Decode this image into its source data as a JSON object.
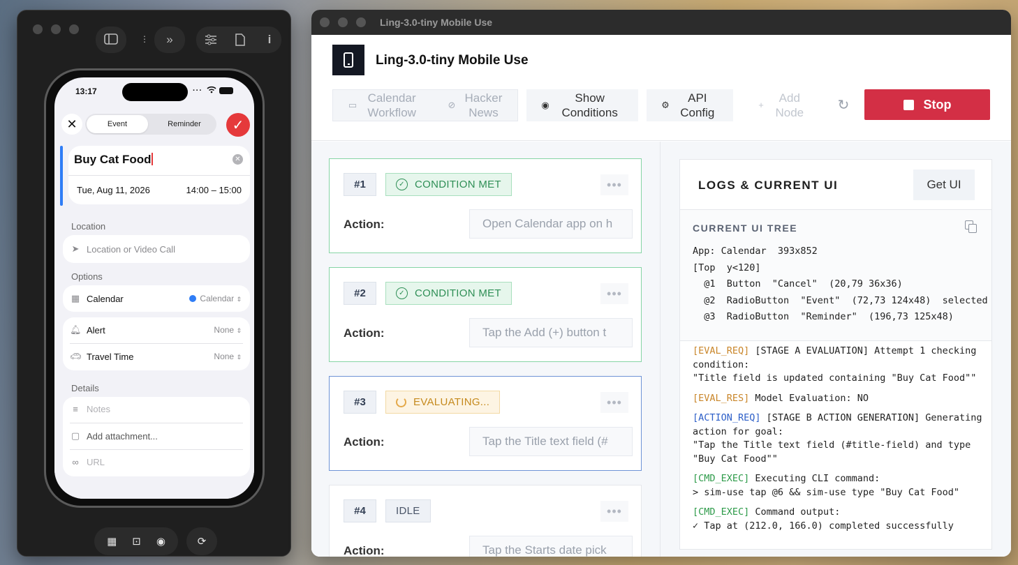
{
  "simulator": {
    "toolbar_icons": [
      "sidebar-icon",
      "hierarchy-icon",
      "forward-icon",
      "sliders-icon",
      "document-icon",
      "info-icon"
    ],
    "status_time": "13:17",
    "event_editor": {
      "segments": [
        "Event",
        "Reminder"
      ],
      "title_value": "Buy Cat Food",
      "date": "Tue, Aug 11, 2026",
      "time_range": "14:00 – 15:00",
      "location_label": "Location",
      "location_placeholder": "Location or Video Call",
      "options_label": "Options",
      "calendar_label": "Calendar",
      "calendar_value": "Calendar",
      "alert_label": "Alert",
      "alert_value": "None",
      "travel_label": "Travel Time",
      "travel_value": "None",
      "details_label": "Details",
      "notes_placeholder": "Notes",
      "attachment_label": "Add attachment...",
      "url_placeholder": "URL"
    },
    "dock_icons": [
      "grid-icon",
      "screenshot-icon",
      "record-icon",
      "rotate-icon"
    ]
  },
  "app": {
    "window_title": "Ling-3.0-tiny Mobile Use",
    "title": "Ling-3.0-tiny Mobile Use",
    "toolbar": {
      "calendar_workflow": "Calendar Workflow",
      "hacker_news": "Hacker News",
      "show_conditions": "Show Conditions",
      "api_config": "API Config",
      "add_node": "Add Node",
      "stop": "Stop"
    },
    "action_label": "Action:",
    "steps": [
      {
        "num": "#1",
        "status": "CONDITION MET",
        "action": "Open Calendar app on h"
      },
      {
        "num": "#2",
        "status": "CONDITION MET",
        "action": "Tap the Add (+) button t"
      },
      {
        "num": "#3",
        "status": "EVALUATING...",
        "action": "Tap the Title text field (#"
      },
      {
        "num": "#4",
        "status": "IDLE",
        "action": "Tap the Starts date pick"
      }
    ],
    "logs": {
      "title": "LOGS & CURRENT UI",
      "get_ui": "Get UI",
      "tree_title": "CURRENT UI TREE",
      "tree_lines": [
        "App: Calendar  393x852",
        "",
        "[Top  y<120]",
        "  @1  Button  \"Cancel\"  (20,79 36x36)",
        "  @2  RadioButton  \"Event\"  (72,73 124x48)  selected",
        "  @3  RadioButton  \"Reminder\"  (196,73 125x48)"
      ],
      "entries": [
        {
          "tag": "[EVAL_REQ]",
          "text": " [STAGE A EVALUATION] Attempt 1 checking condition:\n\"Title field is updated containing \"Buy Cat Food\"\""
        },
        {
          "tag": "[EVAL_RES]",
          "text": " Model Evaluation: NO"
        },
        {
          "tag": "[ACTION_REQ]",
          "text": " [STAGE B ACTION GENERATION] Generating action for goal:\n\"Tap the Title text field (#title-field) and type \"Buy Cat Food\"\""
        },
        {
          "tag": "[CMD_EXEC]",
          "text": " Executing CLI command:\n> sim-use tap @6 && sim-use type \"Buy Cat Food\""
        },
        {
          "tag": "[CMD_EXEC]",
          "text": " Command output:\n✓ Tap at (212.0, 166.0) completed successfully"
        }
      ]
    }
  },
  "colors": {
    "stop": "#d32f45",
    "condition_met": "#2f8f56",
    "evaluating": "#c58a1e",
    "ios_red": "#e5393b",
    "ios_blue": "#2f7df6"
  }
}
